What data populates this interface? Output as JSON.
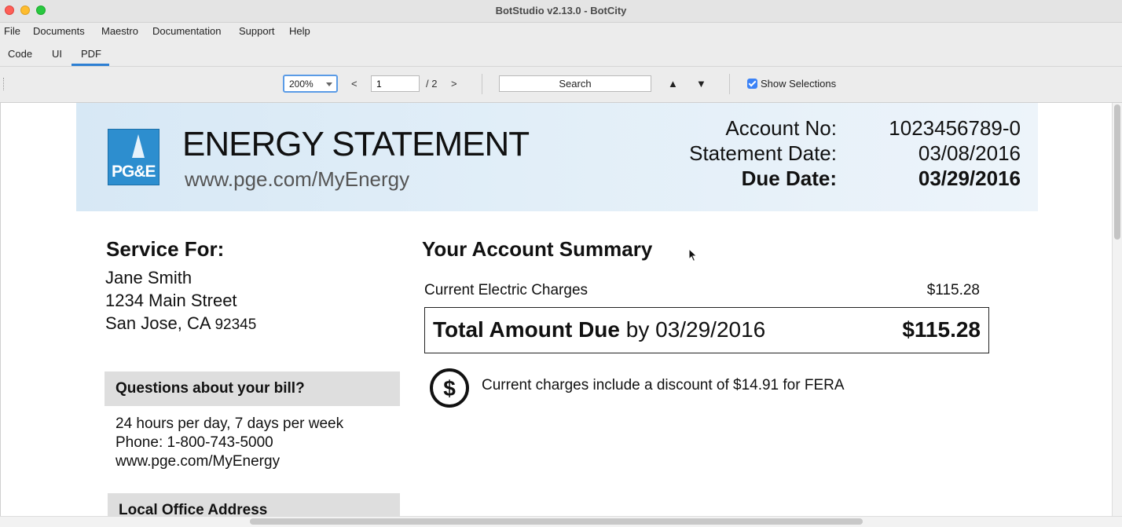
{
  "window": {
    "title": "BotStudio v2.13.0 - BotCity"
  },
  "menu": [
    "File",
    "Documents",
    "Maestro",
    "Documentation",
    "Support",
    "Help"
  ],
  "tabs": [
    "Code",
    "UI",
    "PDF"
  ],
  "toolbar": {
    "zoom": "200%",
    "prev": "<",
    "next": ">",
    "page": "1",
    "page_total": "/ 2",
    "search_label": "Search",
    "up_arrow": "▲",
    "down_arrow": "▼",
    "show_selections": "Show Selections",
    "show_selections_checked": true
  },
  "document": {
    "title": "ENERGY STATEMENT",
    "website": "www.pge.com/MyEnergy",
    "logo_text": "PG&E",
    "account": {
      "account_no_label": "Account No:",
      "account_no": "1023456789-0",
      "statement_date_label": "Statement Date:",
      "statement_date": "03/08/2016",
      "due_date_label": "Due Date:",
      "due_date": "03/29/2016"
    },
    "service": {
      "heading": "Service For:",
      "name": "Jane Smith",
      "street": "1234 Main Street",
      "city_state": "San Jose, CA",
      "zip": "92345"
    },
    "questions": {
      "heading": "Questions about your bill?",
      "hours": "24 hours per day, 7 days per week",
      "phone": "Phone: 1-800-743-5000",
      "website": "www.pge.com/MyEnergy"
    },
    "local_office": {
      "heading": "Local Office Address"
    },
    "summary": {
      "heading": "Your Account Summary",
      "charge_label": "Current Electric Charges",
      "charge_value": "$115.28",
      "total_label": "Total Amount Due",
      "total_by": "by 03/29/2016",
      "total_value": "$115.28",
      "discount_text": "Current charges include a discount of $14.91 for FERA"
    }
  }
}
